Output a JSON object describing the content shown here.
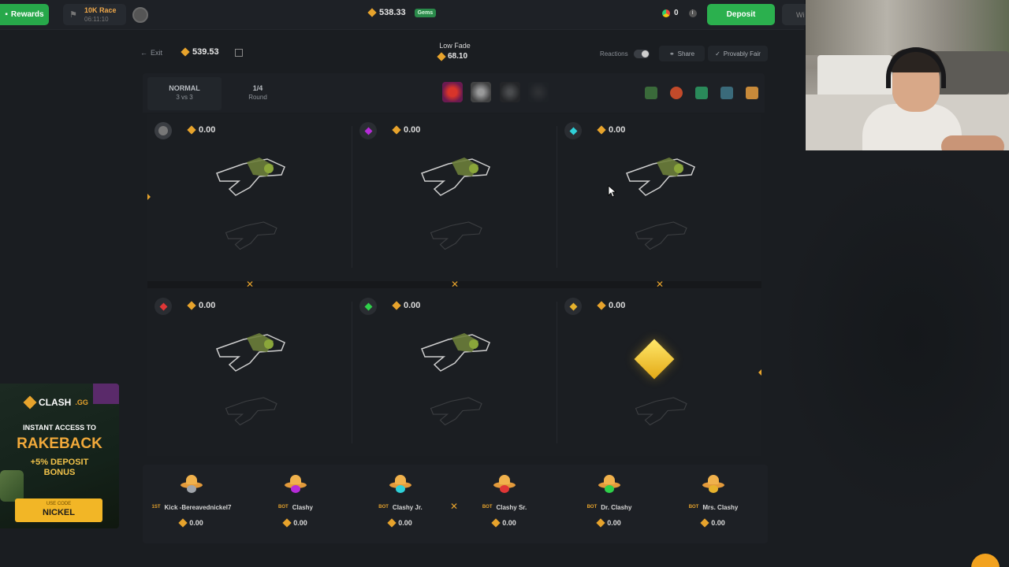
{
  "topbar": {
    "rewards_label": "Rewards",
    "race_title": "10K Race",
    "race_timer": "06:11:10",
    "balance": "538.33",
    "gems_label": "Gems",
    "coin_count": "0",
    "deposit_label": "Deposit",
    "withdraw_label": "Wi"
  },
  "battle_header": {
    "exit_label": "Exit",
    "battle_value": "539.53",
    "mode_title": "Low Fade",
    "mode_value": "68.10",
    "reactions_label": "Reactions",
    "share_label": "Share",
    "provably_fair_label": "Provably Fair"
  },
  "info": {
    "mode": "NORMAL",
    "mode_sub": "3 vs 3",
    "round": "1/4",
    "round_sub": "Round"
  },
  "slots": [
    {
      "amount": "0.00",
      "marker": "avatar"
    },
    {
      "amount": "0.00",
      "marker": "#b62bd8"
    },
    {
      "amount": "0.00",
      "marker": "#2fd0d8"
    },
    {
      "amount": "0.00",
      "marker": "#e03636"
    },
    {
      "amount": "0.00",
      "marker": "#2fd04a"
    },
    {
      "amount": "0.00",
      "marker": "#e7b22c"
    }
  ],
  "players": [
    {
      "tag": "1ST",
      "name": "Kick -Bereavednickel7",
      "amount": "0.00"
    },
    {
      "tag": "BOT",
      "name": "Clashy",
      "amount": "0.00"
    },
    {
      "tag": "BOT",
      "name": "Clashy Jr.",
      "amount": "0.00"
    },
    {
      "tag": "BOT",
      "name": "Clashy Sr.",
      "amount": "0.00"
    },
    {
      "tag": "BOT",
      "name": "Dr. Clashy",
      "amount": "0.00"
    },
    {
      "tag": "BOT",
      "name": "Mrs. Clashy",
      "amount": "0.00"
    }
  ],
  "promo": {
    "brand": "CLASH",
    "brand_tld": ".GG",
    "line1": "INSTANT ACCESS TO",
    "line2": "RAKEBACK",
    "line3": "+5% DEPOSIT",
    "line4": "BONUS",
    "code_label": "USE CODE",
    "code_value": "NICKEL"
  },
  "colors": {
    "accent_green": "#2bb04e",
    "gold": "#e7a32c",
    "background": "#1a1d21"
  }
}
